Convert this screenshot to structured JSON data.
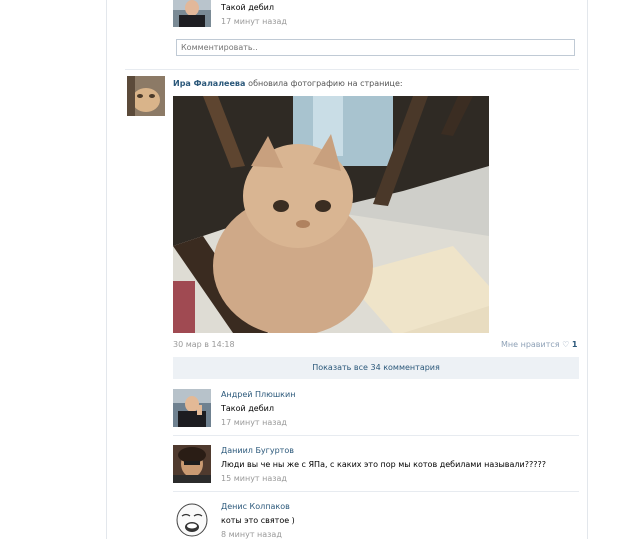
{
  "colors": {
    "link": "#2b587a",
    "muted": "#999999",
    "panel": "#edf1f5",
    "border": "#c0cad5"
  },
  "top_comment": {
    "text": "Такой дебил",
    "time": "17 минут назад",
    "reply_placeholder": "Комментировать.."
  },
  "post": {
    "author": "Ира Фалалеева",
    "action": "обновила фотографию на странице:",
    "date": "30 мар в 14:18",
    "like_label": "Мне нравится",
    "like_icon": "heart-icon",
    "like_count": "1",
    "show_all": "Показать все 34 комментария"
  },
  "comments": [
    {
      "author": "Андрей Плюшкин",
      "text": "Такой дебил",
      "time": "17 минут назад"
    },
    {
      "author": "Даниил Бугуртов",
      "text": "Люди вы че ны же с ЯПа, с каких это пор мы котов дебилами называли?????",
      "time": "15 минут назад"
    },
    {
      "author": "Денис Колпаков",
      "text": "коты это святое )",
      "time": "8 минут назад"
    }
  ]
}
